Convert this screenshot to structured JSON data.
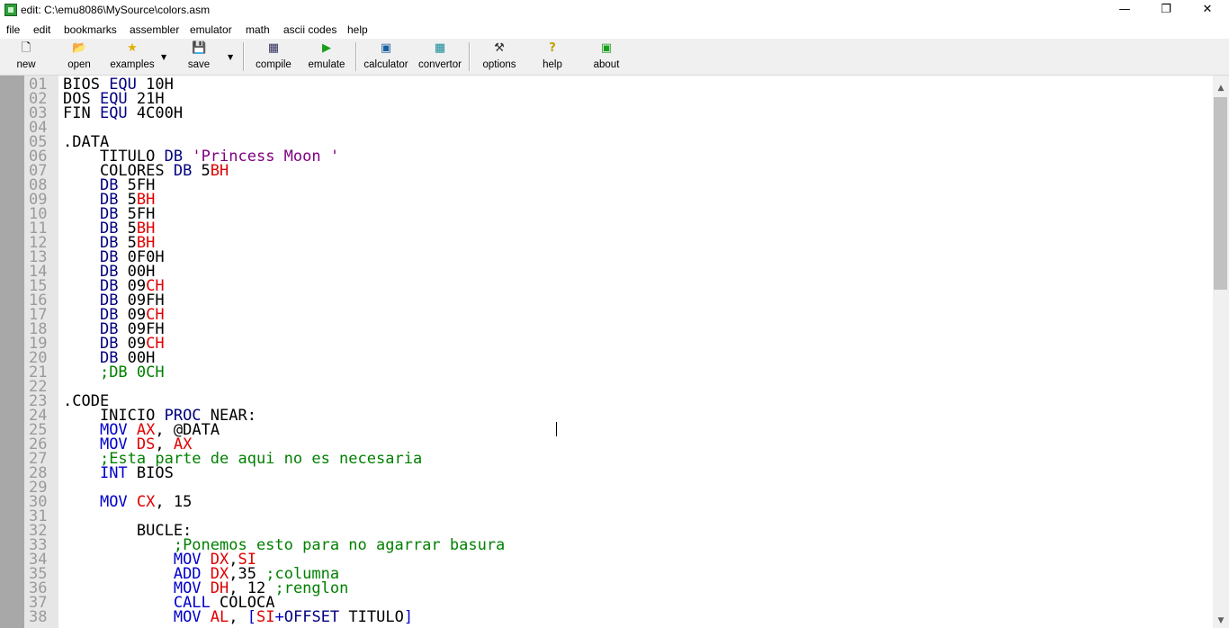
{
  "window": {
    "title": "edit: C:\\emu8086\\MySource\\colors.asm",
    "minimize_glyph": "—",
    "restore_glyph": "❐",
    "close_glyph": "✕"
  },
  "menu": [
    "file",
    "edit",
    "bookmarks",
    "assembler",
    "emulator",
    "math",
    "ascii codes",
    "help"
  ],
  "toolbar": {
    "new": {
      "label": "new",
      "icon": "new-file-icon",
      "glyph": "🗋",
      "color": "#000000"
    },
    "open": {
      "label": "open",
      "icon": "open-folder-icon",
      "glyph": "📂",
      "color": "#b08a00"
    },
    "examples": {
      "label": "examples",
      "icon": "star-icon",
      "glyph": "★",
      "color": "#e0b000"
    },
    "save": {
      "label": "save",
      "icon": "floppy-icon",
      "glyph": "💾",
      "color": "#000000"
    },
    "compile": {
      "label": "compile",
      "icon": "compile-icon",
      "glyph": "▦",
      "color": "#303060"
    },
    "emulate": {
      "label": "emulate",
      "icon": "play-icon",
      "glyph": "▶",
      "color": "#1a9e1a"
    },
    "calculator": {
      "label": "calculator",
      "icon": "calculator-icon",
      "glyph": "▣",
      "color": "#1a5e9e"
    },
    "convertor": {
      "label": "convertor",
      "icon": "convertor-icon",
      "glyph": "▦",
      "color": "#138a9a"
    },
    "options": {
      "label": "options",
      "icon": "tools-icon",
      "glyph": "⚒",
      "color": "#303030"
    },
    "help": {
      "label": "help",
      "icon": "help-icon",
      "glyph": "?",
      "color": "#c0a000"
    },
    "about": {
      "label": "about",
      "icon": "chip-icon",
      "glyph": "▣",
      "color": "#1a9e1a"
    },
    "dropdown_glyph": "▼"
  },
  "colors": {
    "keyword": "#0000cc",
    "directive": "#000080",
    "register": "#e00000",
    "comment": "#008000",
    "string": "#800080",
    "line_number": "#9a9a9a"
  },
  "code": [
    {
      "ln": "01",
      "text": "BIOS EQU 10H"
    },
    {
      "ln": "02",
      "text": "DOS EQU 21H"
    },
    {
      "ln": "03",
      "text": "FIN EQU 4C00H"
    },
    {
      "ln": "04",
      "text": ""
    },
    {
      "ln": "05",
      "text": ".DATA"
    },
    {
      "ln": "06",
      "text": "    TITULO DB 'Princess Moon '"
    },
    {
      "ln": "07",
      "text": "    COLORES DB 5BH"
    },
    {
      "ln": "08",
      "text": "    DB 5FH"
    },
    {
      "ln": "09",
      "text": "    DB 5BH"
    },
    {
      "ln": "10",
      "text": "    DB 5FH"
    },
    {
      "ln": "11",
      "text": "    DB 5BH"
    },
    {
      "ln": "12",
      "text": "    DB 5BH"
    },
    {
      "ln": "13",
      "text": "    DB 0F0H"
    },
    {
      "ln": "14",
      "text": "    DB 00H"
    },
    {
      "ln": "15",
      "text": "    DB 09CH"
    },
    {
      "ln": "16",
      "text": "    DB 09FH"
    },
    {
      "ln": "17",
      "text": "    DB 09CH"
    },
    {
      "ln": "18",
      "text": "    DB 09FH"
    },
    {
      "ln": "19",
      "text": "    DB 09CH"
    },
    {
      "ln": "20",
      "text": "    DB 00H"
    },
    {
      "ln": "21",
      "text": "    ;DB 0CH"
    },
    {
      "ln": "22",
      "text": ""
    },
    {
      "ln": "23",
      "text": ".CODE"
    },
    {
      "ln": "24",
      "text": "    INICIO PROC NEAR:"
    },
    {
      "ln": "25",
      "text": "    MOV AX, @DATA"
    },
    {
      "ln": "26",
      "text": "    MOV DS, AX"
    },
    {
      "ln": "27",
      "text": "    ;Esta parte de aqui no es necesaria"
    },
    {
      "ln": "28",
      "text": "    INT BIOS"
    },
    {
      "ln": "29",
      "text": ""
    },
    {
      "ln": "30",
      "text": "    MOV CX, 15"
    },
    {
      "ln": "31",
      "text": ""
    },
    {
      "ln": "32",
      "text": "        BUCLE:"
    },
    {
      "ln": "33",
      "text": "            ;Ponemos esto para no agarrar basura"
    },
    {
      "ln": "34",
      "text": "            MOV DX,SI"
    },
    {
      "ln": "35",
      "text": "            ADD DX,35 ;columna"
    },
    {
      "ln": "36",
      "text": "            MOV DH, 12 ;renglon"
    },
    {
      "ln": "37",
      "text": "            CALL COLOCA"
    },
    {
      "ln": "38",
      "text": "            MOV AL, [SI+OFFSET TITULO]"
    }
  ],
  "scrollbar": {
    "up_glyph": "▲",
    "down_glyph": "▼"
  }
}
